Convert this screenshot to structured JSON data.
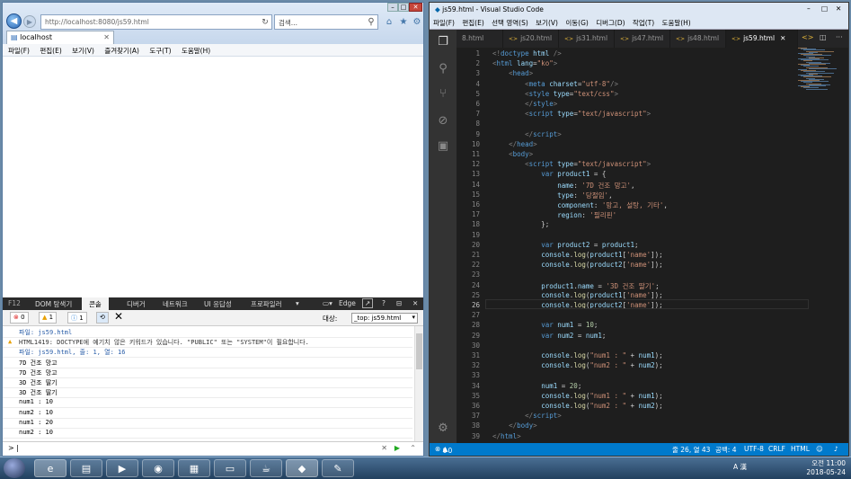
{
  "ie": {
    "address": "http://localhost:8080/js59.html",
    "search_placeholder": "검색...",
    "tab_title": "localhost",
    "menu": [
      "파일(F)",
      "편집(E)",
      "보기(V)",
      "즐겨찾기(A)",
      "도구(T)",
      "도움말(H)"
    ]
  },
  "devtools": {
    "tabs": [
      "F12",
      "DOM 탐색기",
      "콘솔",
      "디버거",
      "네트워크",
      "UI 응답성",
      "프로파일러"
    ],
    "emulation": "Edge",
    "error_count": "0",
    "warning_count": "1",
    "info_count": "1",
    "target_label": "대상:",
    "target_value": "_top: js59.html",
    "console_lines": [
      "파일: js59.html",
      "HTML1419: DOCTYPE에 예기치 않은 키워드가 있습니다. \"PUBLIC\" 또는 \"SYSTEM\"이 필요합니다.",
      "파일: js59.html, 줄: 1, 열: 16",
      "7D 건조 망고",
      "7D 건조 망고",
      "3D 건조 딸기",
      "3D 건조 딸기",
      "num1 : 10",
      "num2 : 10",
      "num1 : 20",
      "num2 : 10"
    ],
    "prompt": ">"
  },
  "vscode": {
    "title": "js59.html - Visual Studio Code",
    "menu": [
      "파일(F)",
      "편집(E)",
      "선택 영역(S)",
      "보기(V)",
      "이동(G)",
      "디버그(D)",
      "작업(T)",
      "도움말(H)"
    ],
    "tabs": [
      "8.html",
      "js20.html",
      "js31.html",
      "js47.html",
      "js48.html",
      "js59.html"
    ],
    "active_tab": "js59.html",
    "status": {
      "errors": "0",
      "warnings": "0",
      "position": "줄 26, 열 43",
      "spaces": "공백: 4",
      "encoding": "UTF-8",
      "eol": "CRLF",
      "language": "HTML"
    }
  },
  "taskbar": {
    "time": "오전 11:00",
    "date": "2018-05-24",
    "ime": "A 漢"
  },
  "colors": {
    "vscode_status": "#007acc",
    "editor_bg": "#1e1e1e",
    "tag": "#569cd6",
    "string": "#ce9178"
  }
}
